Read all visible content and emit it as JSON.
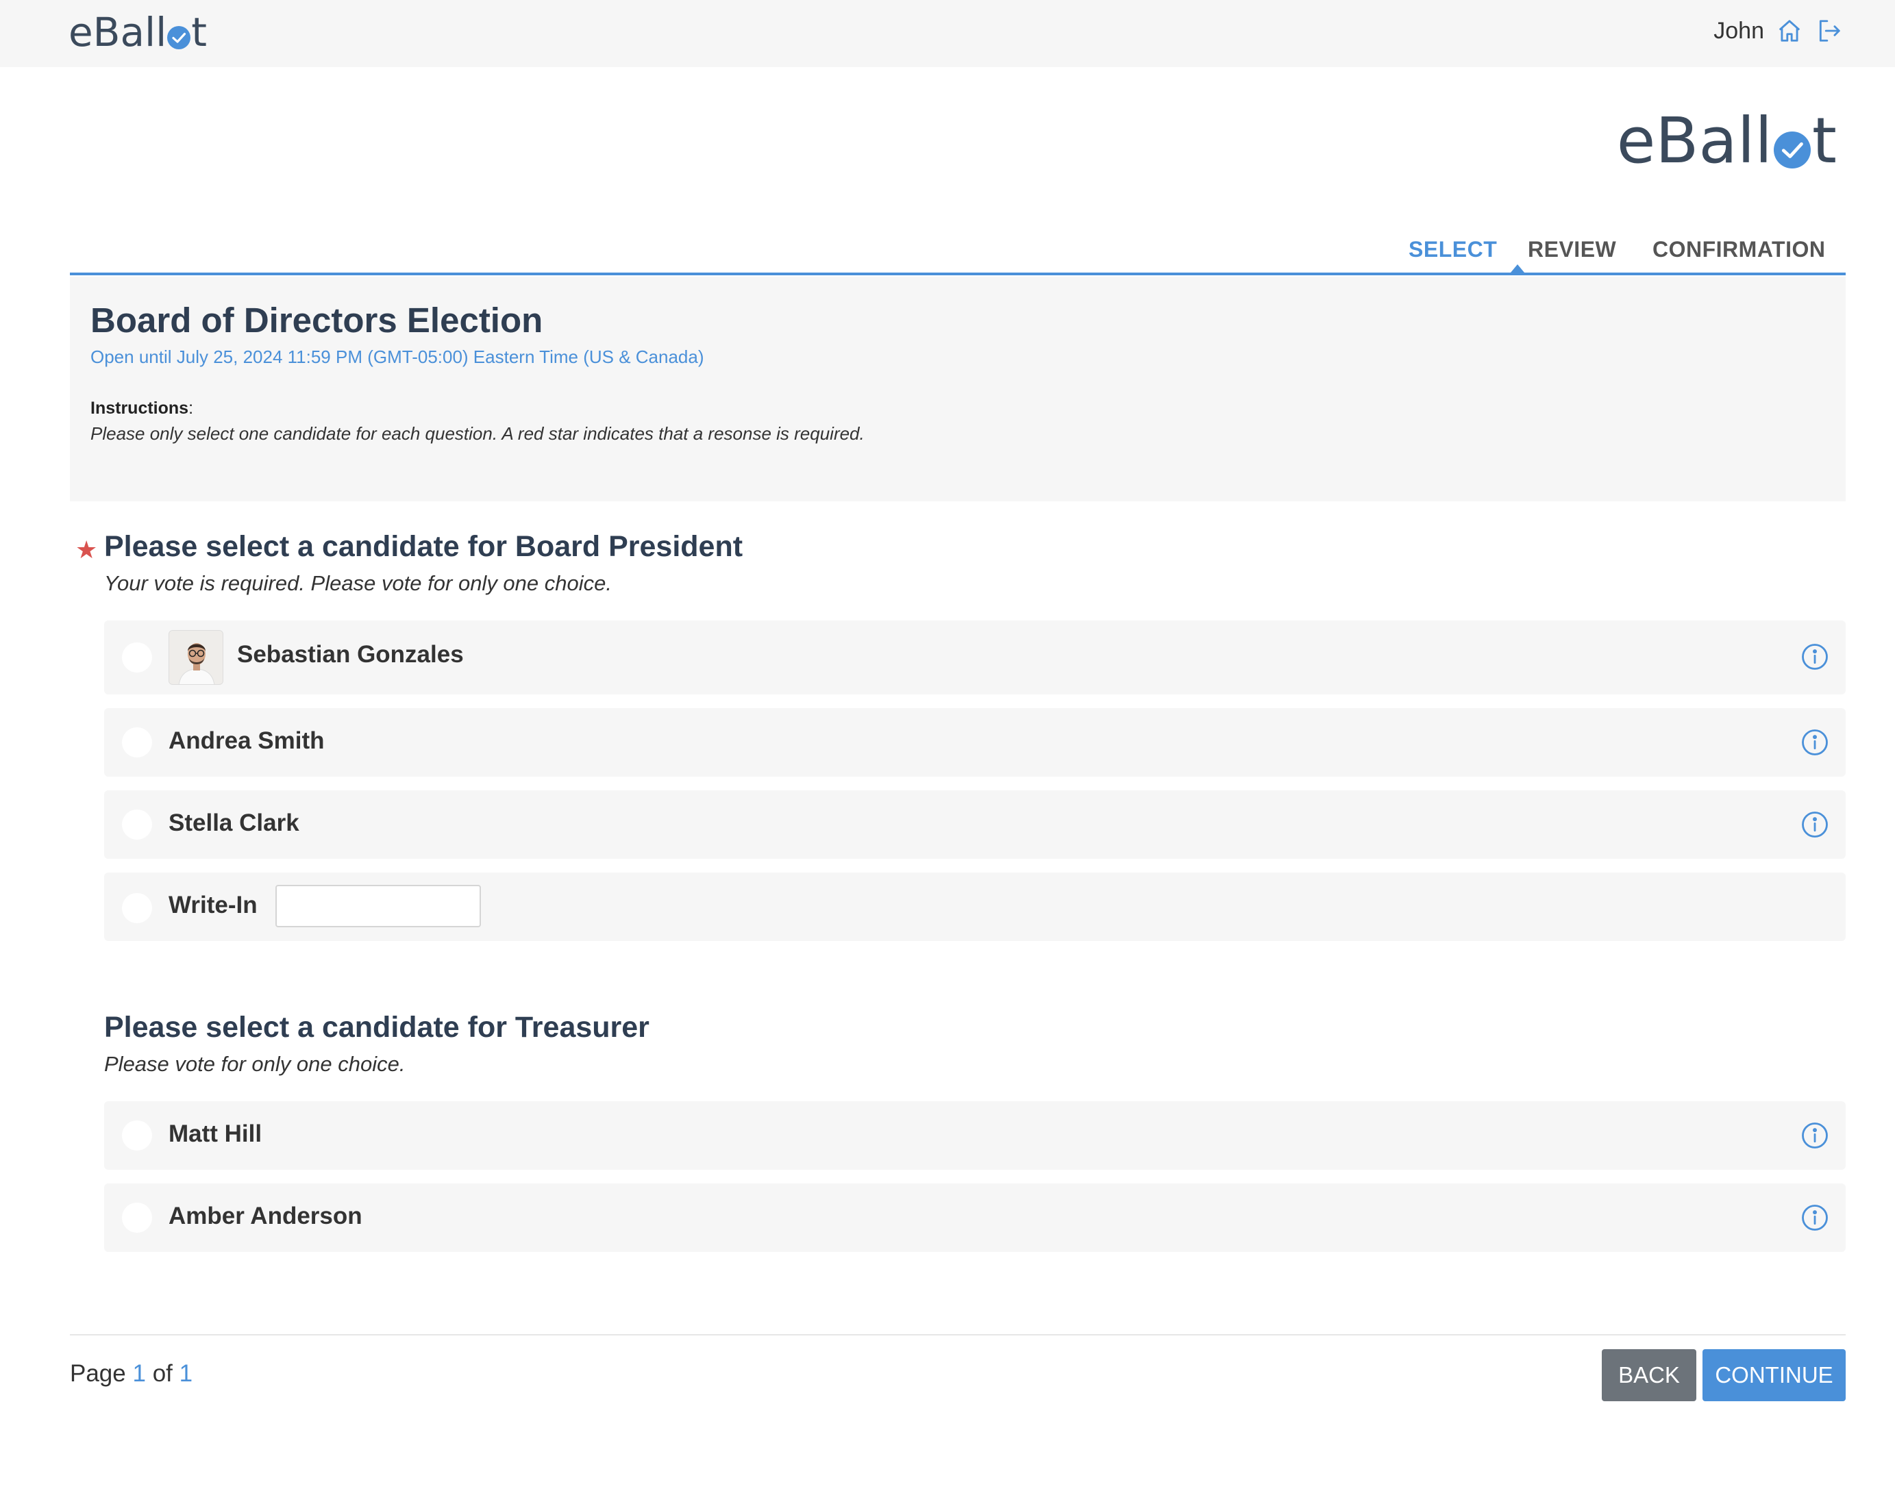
{
  "app": {
    "logo_text_prefix": "eBall",
    "logo_text_suffix": "t"
  },
  "header": {
    "username": "John"
  },
  "steps": [
    "SELECT",
    "REVIEW",
    "CONFIRMATION"
  ],
  "election": {
    "title": "Board of Directors Election",
    "open_until": "Open until July 25, 2024 11:59 PM (GMT-05:00) Eastern Time (US & Canada)",
    "instructions_label": "Instructions",
    "instructions_text": "Please only select one candidate for each question. A red star indicates that a resonse is required."
  },
  "questions": [
    {
      "required_mark": "★",
      "title": "Please select a candidate for Board President",
      "subtitle": "Your vote is required. Please vote for only one choice.",
      "options": [
        "Sebastian Gonzales",
        "Andrea Smith",
        "Stella Clark",
        "Write-In"
      ]
    },
    {
      "title": "Please select a candidate for Treasurer",
      "subtitle": "Please vote for only one choice.",
      "options": [
        "Matt Hill",
        "Amber Anderson"
      ]
    }
  ],
  "footer": {
    "page_word": "Page",
    "current_page": "1",
    "of_word": "of",
    "total_pages": "1",
    "back_label": "BACK",
    "continue_label": "CONTINUE"
  },
  "colors": {
    "accent": "#4a90d9",
    "required": "#d9534f",
    "heading": "#2f3e52",
    "panel": "#f6f6f6",
    "back_button": "#6c737a"
  },
  "icons": [
    "home-icon",
    "logout-icon",
    "info-icon",
    "check-icon"
  ]
}
